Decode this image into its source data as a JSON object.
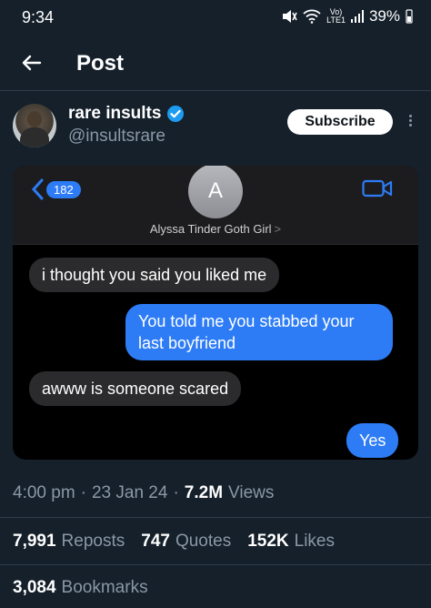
{
  "status_bar": {
    "time": "9:34",
    "network_top": "Vo)",
    "network_bottom": "LTE1",
    "battery": "39%"
  },
  "header": {
    "title": "Post"
  },
  "author": {
    "name": "rare insults",
    "handle": "@insultsrare",
    "subscribe_label": "Subscribe"
  },
  "screenshot": {
    "back_count": "182",
    "contact_initial": "A",
    "contact_name": "Alyssa Tinder Goth Girl",
    "contact_chevron": ">",
    "messages": [
      {
        "text": "i thought you said you liked me",
        "sender": "them"
      },
      {
        "text": "You told me you stabbed your last boyfriend",
        "sender": "me"
      },
      {
        "text": "awww is someone scared",
        "sender": "them"
      },
      {
        "text": "Yes",
        "sender": "me"
      }
    ]
  },
  "meta": {
    "time": "4:00 pm",
    "sep1": "·",
    "date": "23 Jan 24",
    "sep2": "·",
    "views_count": "7.2M",
    "views_label": "Views"
  },
  "engagement": {
    "reposts_count": "7,991",
    "reposts_label": "Reposts",
    "quotes_count": "747",
    "quotes_label": "Quotes",
    "likes_count": "152K",
    "likes_label": "Likes",
    "bookmarks_count": "3,084",
    "bookmarks_label": "Bookmarks"
  },
  "colors": {
    "background": "#15202b",
    "accent_blue": "#1d9bf0",
    "imessage_blue": "#2d7cf6"
  }
}
